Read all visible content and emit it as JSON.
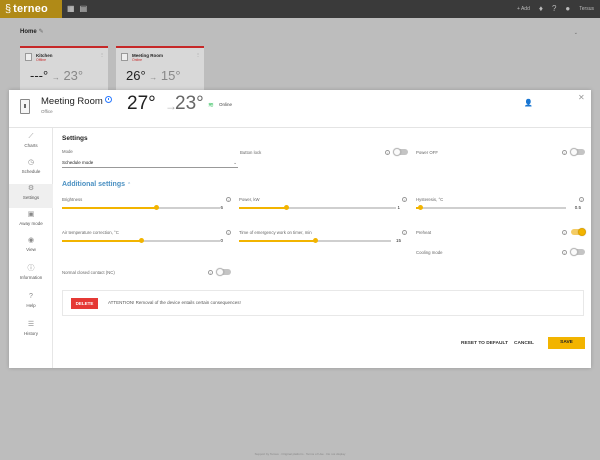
{
  "app": {
    "logo_text": "terneo",
    "top_right": {
      "add_label": "+ Add",
      "user_label": "Tersus"
    }
  },
  "home": {
    "title": "Home",
    "cards": [
      {
        "name": "Kitchen",
        "sub": "Offline",
        "current": "---°",
        "target": "23°"
      },
      {
        "name": "Meeting Room",
        "sub": "Online",
        "current": "26°",
        "target": "15°"
      }
    ]
  },
  "modal": {
    "device_name": "Meeting Room",
    "device_sub": "Office",
    "current_temp": "27°",
    "target_temp": "23°",
    "status": "Online",
    "sidebar": [
      {
        "label": "Charts",
        "icon": "chart-icon"
      },
      {
        "label": "Schedule",
        "icon": "clock-icon"
      },
      {
        "label": "Settings",
        "icon": "gear-icon"
      },
      {
        "label": "Away mode",
        "icon": "briefcase-icon"
      },
      {
        "label": "View",
        "icon": "eye-icon"
      },
      {
        "label": "Information",
        "icon": "info-icon"
      },
      {
        "label": "Help",
        "icon": "help-icon"
      },
      {
        "label": "History",
        "icon": "list-icon"
      }
    ],
    "settings": {
      "title": "Settings",
      "mode_label": "Mode",
      "mode_value": "Schedule mode",
      "button_lock_label": "Button lock",
      "power_off_label": "Power OFF",
      "additional_title": "Additional settings",
      "brightness": {
        "label": "Brightness",
        "value": "6",
        "fraction": 0.6
      },
      "power_kw": {
        "label": "Power, kW",
        "value": "1",
        "fraction": 0.3
      },
      "hysteresis": {
        "label": "Hysteresis, °C",
        "value": "0.5",
        "fraction": 0.03
      },
      "air_temp_correction": {
        "label": "Air temperature correction, °C",
        "value": "0",
        "fraction": 0.5
      },
      "emergency_time": {
        "label": "Time of emergency work on timer, min",
        "value": "15",
        "fraction": 0.5
      },
      "preheat_label": "Preheat",
      "cooling_mode_label": "Cooling mode",
      "nc_label": "Normal closed contact (NC)",
      "delete_label": "DELETE",
      "warning": "ATTENTION! Removal of the device entails certain consequences!",
      "reset_label": "RESET TO DEFAULT",
      "cancel_label": "CANCEL",
      "save_label": "SAVE"
    }
  },
  "footer": "Support by Tersus · Original platform · Terms of Use · Do not display"
}
